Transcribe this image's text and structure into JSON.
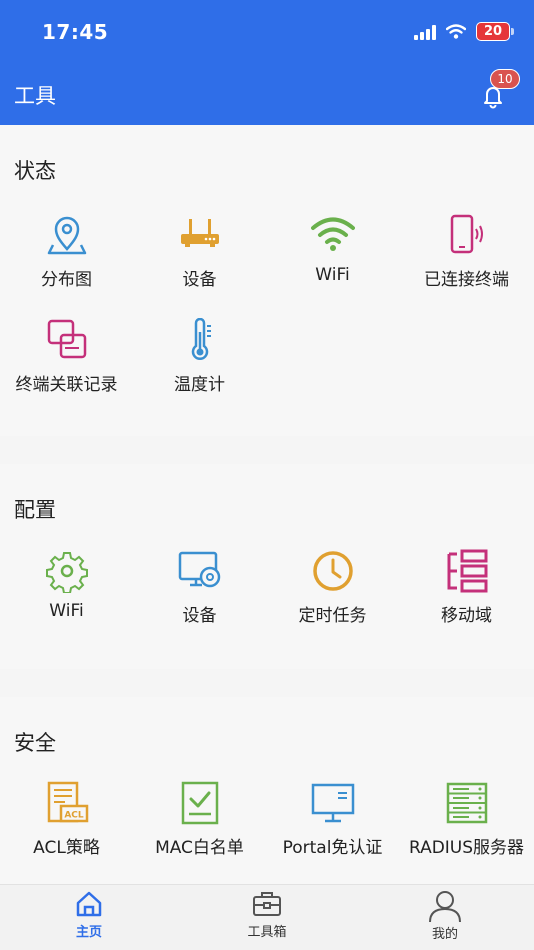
{
  "status_bar": {
    "time": "17:45",
    "battery": "20"
  },
  "header": {
    "title": "工具",
    "notification_count": "10"
  },
  "sections": [
    {
      "title": "状态",
      "items": [
        {
          "label": "分布图",
          "icon": "map-pin-icon"
        },
        {
          "label": "设备",
          "icon": "router-icon"
        },
        {
          "label": "WiFi",
          "icon": "wifi-icon"
        },
        {
          "label": "已连接终端",
          "icon": "phone-signal-icon"
        },
        {
          "label": "终端关联记录",
          "icon": "linked-records-icon"
        },
        {
          "label": "温度计",
          "icon": "thermometer-icon"
        }
      ]
    },
    {
      "title": "配置",
      "items": [
        {
          "label": "WiFi",
          "icon": "wifi-settings-gear-icon"
        },
        {
          "label": "设备",
          "icon": "monitor-settings-icon"
        },
        {
          "label": "定时任务",
          "icon": "clock-icon"
        },
        {
          "label": "移动域",
          "icon": "domain-list-icon"
        }
      ]
    },
    {
      "title": "安全",
      "items": [
        {
          "label": "ACL策略",
          "icon": "acl-document-icon"
        },
        {
          "label": "MAC白名单",
          "icon": "checklist-icon"
        },
        {
          "label": "Portal免认证",
          "icon": "monitor-icon"
        },
        {
          "label": "RADIUS服务器",
          "icon": "server-rack-icon"
        }
      ]
    }
  ],
  "tabbar": {
    "tabs": [
      {
        "label": "主页",
        "icon": "home-icon",
        "active": true
      },
      {
        "label": "工具箱",
        "icon": "toolbox-icon",
        "active": false
      },
      {
        "label": "我的",
        "icon": "user-icon",
        "active": false
      }
    ]
  },
  "colors": {
    "brand": "#2f6ee8",
    "badge": "#d9534f",
    "map_blue": "#3a8fd0",
    "device_orange": "#e0a030",
    "wifi_green": "#6ab04c",
    "magenta": "#c4307a"
  }
}
